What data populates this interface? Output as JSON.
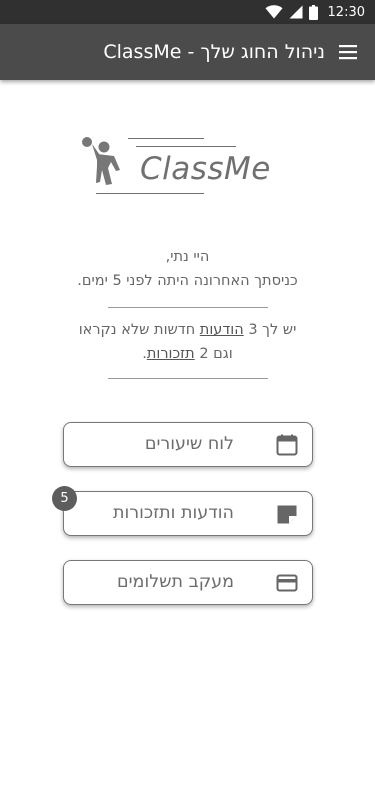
{
  "status_bar": {
    "time": "12:30",
    "icons": [
      "wifi-icon",
      "signal-icon",
      "battery-icon"
    ]
  },
  "app_bar": {
    "title": "ניהול החוג שלך - ClassMe",
    "menu_icon": "hamburger-menu-icon"
  },
  "logo": {
    "text": "ClassMe",
    "icon": "volleyball-player-icon"
  },
  "greeting": {
    "line1": "היי נתי,",
    "line2": "כניסתך האחרונה היתה לפני 5 ימים."
  },
  "notifications": {
    "prefix": "יש לך 3",
    "messages_link": "הודעות",
    "suffix": "חדשות שלא נקראו",
    "line2_prefix": "וגם 2",
    "reminders_link": "תזכורות",
    "line2_suffix": "."
  },
  "buttons": {
    "schedule": {
      "label": "לוח שיעורים",
      "icon": "calendar-icon"
    },
    "messages": {
      "label": "הודעות ותזכורות",
      "icon": "note-icon",
      "badge": "5"
    },
    "payments": {
      "label": "מעקב תשלומים",
      "icon": "credit-card-icon"
    }
  },
  "colors": {
    "status_bar": "#303030",
    "app_bar": "#4b4b4b",
    "badge": "#5d5d5d"
  }
}
